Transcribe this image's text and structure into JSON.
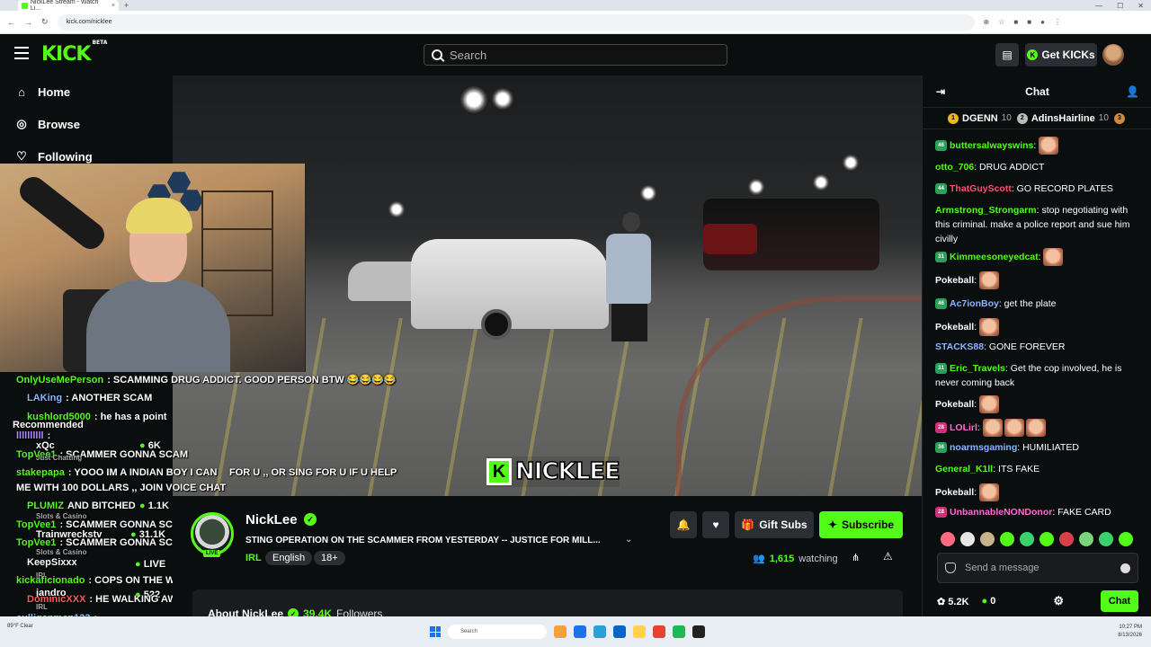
{
  "browser": {
    "tab_title": "NickLee Stream - Watch Li...",
    "url": "kick.com/nicklee"
  },
  "header": {
    "logo": "KICK",
    "logo_beta": "BETA",
    "search_placeholder": "Search",
    "get_kicks": "Get KICKs"
  },
  "sidebar": {
    "home": "Home",
    "browse": "Browse",
    "following": "Following",
    "recommended": "Recommended"
  },
  "video": {
    "overlay_name": "NICKLEE"
  },
  "overlay_chat": [
    {
      "user": "OnlyUseMePerson",
      "text": ": SCAMMING DRUG ADDICT. GOOD PERSON BTW 😂😂😂😂",
      "color": "#53fc18"
    },
    {
      "user": "LAKing",
      "text": ": ANOTHER SCAM",
      "color": "#8ab4ff"
    },
    {
      "user": "kushlord5000",
      "text": ": he has a point",
      "color": "#53fc18"
    },
    {
      "user": "llllllllll",
      "text": ":",
      "color": "#b38aff"
    },
    {
      "user": "xQc",
      "text": "6K",
      "color": "#fff"
    },
    {
      "user": "TopVee1",
      "text": ": SCAMMER GONNA SCAM",
      "color": "#53fc18"
    },
    {
      "user": "stakepapa",
      "text": ": YOOO IM A INDIAN BOY I CAN",
      "color": "#53fc18"
    },
    {
      "user": "",
      "text": "FOR U ,, OR SING FOR U IF U HELP",
      "color": "#fff"
    },
    {
      "user": "",
      "text": "ME WITH 100 DOLLARS ,, JOIN VOICE CHAT",
      "color": "#fff"
    },
    {
      "user": "PLUMIZ",
      "text": "AND BITCHED",
      "color": "#53fc18"
    },
    {
      "user": "TopVee1",
      "text": ": SCAMMER GONNA SCAM",
      "color": "#53fc18"
    },
    {
      "user": "Trainwreckstv",
      "text": "31.1K",
      "color": "#fff"
    },
    {
      "user": "TopVee1",
      "text": ": SCAMMER GONNA SCAM",
      "color": "#53fc18"
    },
    {
      "user": "KeepSixxx",
      "text": "LIVE",
      "color": "#fff"
    },
    {
      "user": "kickaficionado",
      "text": ": COPS ON THE WAY",
      "color": "#53fc18"
    },
    {
      "user": "DominicXXX",
      "text": ": HE WALKING AWAY FREE",
      "color": "#ff5a5a"
    },
    {
      "user": "culliganman123",
      "text": ":",
      "color": "#8ab4ff"
    }
  ],
  "overlay_side": {
    "slots_casino_1": "Slots & Casino",
    "slots_casino_2": "Slots & Casino",
    "jandro": "jandro",
    "irl": "IRL",
    "val_1_1k": "1.1K",
    "val_522": "522",
    "just_chatting": "Just Chatting"
  },
  "stream": {
    "name": "NickLee",
    "title": "STING OPERATION ON THE SCAMMER FROM YESTERDAY -- JUSTICE FOR MILL...",
    "category": "IRL",
    "tags": [
      "English",
      "18+"
    ],
    "watching_count": "1,615",
    "watching_label": "watching",
    "gift_subs": "Gift Subs",
    "subscribe": "Subscribe",
    "about_label": "About NickLee",
    "followers_count": "39.4K",
    "followers_label": "Followers"
  },
  "chat": {
    "title": "Chat",
    "leaderboard": [
      {
        "rank": "1",
        "name": "DGENN",
        "count": "10",
        "color": "#e8b923"
      },
      {
        "rank": "2",
        "name": "AdinsHairline",
        "count": "10",
        "color": "#bbbbbb"
      },
      {
        "rank": "3",
        "name": "",
        "count": "",
        "color": "#d08a3a"
      }
    ],
    "messages": [
      {
        "badge": "46",
        "badge_color": "#2aa05a",
        "user": "buttersalwayswins",
        "user_color": "#53fc18",
        "text": ":"
      },
      {
        "badge": "",
        "badge_color": "",
        "user": "otto_706",
        "user_color": "#53fc18",
        "text": ": DRUG ADDICT"
      },
      {
        "badge": "44",
        "badge_color": "#2aa05a",
        "user": "ThatGuyScott",
        "user_color": "#ff4d6d",
        "text": ": GO RECORD PLATES"
      },
      {
        "badge": "",
        "badge_color": "",
        "user": "Armstrong_Strongarm",
        "user_color": "#53fc18",
        "text": ": stop negotiating with this criminal. make a police report and sue him civilly"
      },
      {
        "badge": "31",
        "badge_color": "#2aa05a",
        "user": "Kimmeesoneyedcat",
        "user_color": "#53fc18",
        "text": ":"
      },
      {
        "badge": "",
        "badge_color": "",
        "user": "Pokeball",
        "user_color": "#fff",
        "text": ":"
      },
      {
        "badge": "46",
        "badge_color": "#2aa05a",
        "user": "Ac7ionBoy",
        "user_color": "#8ab4ff",
        "text": ": get the plate"
      },
      {
        "badge": "",
        "badge_color": "",
        "user": "Pokeball",
        "user_color": "#fff",
        "text": ":"
      },
      {
        "badge": "",
        "badge_color": "",
        "user": "STACKS88",
        "user_color": "#8ab4ff",
        "text": ": GONE FOREVER"
      },
      {
        "badge": "31",
        "badge_color": "#2aa05a",
        "user": "Eric_Travels",
        "user_color": "#53fc18",
        "text": ": Get the cop involved, he is never coming back"
      },
      {
        "badge": "",
        "badge_color": "",
        "user": "Pokeball",
        "user_color": "#fff",
        "text": ":"
      },
      {
        "badge": "28",
        "badge_color": "#d0307a",
        "user": "LOLirl",
        "user_color": "#ff6ad5",
        "text": ":"
      },
      {
        "badge": "36",
        "badge_color": "#2aa05a",
        "user": "noarmsgaming",
        "user_color": "#8ab4ff",
        "text": ": HUMILIATED"
      },
      {
        "badge": "",
        "badge_color": "",
        "user": "General_K1ll",
        "user_color": "#53fc18",
        "text": ": ITS FAKE"
      },
      {
        "badge": "",
        "badge_color": "",
        "user": "Pokeball",
        "user_color": "#fff",
        "text": ":"
      },
      {
        "badge": "28",
        "badge_color": "#d0307a",
        "user": "UnbannableNONDonor",
        "user_color": "#ff6ad5",
        "text": ": FAKE CARD"
      }
    ],
    "input_placeholder": "Send a message",
    "kicks_count": "5.2K",
    "points": "0",
    "send": "Chat"
  },
  "taskbar": {
    "search": "Search",
    "weather": "89°F Clear",
    "time": "10:27 PM",
    "date": "8/13/2026"
  }
}
